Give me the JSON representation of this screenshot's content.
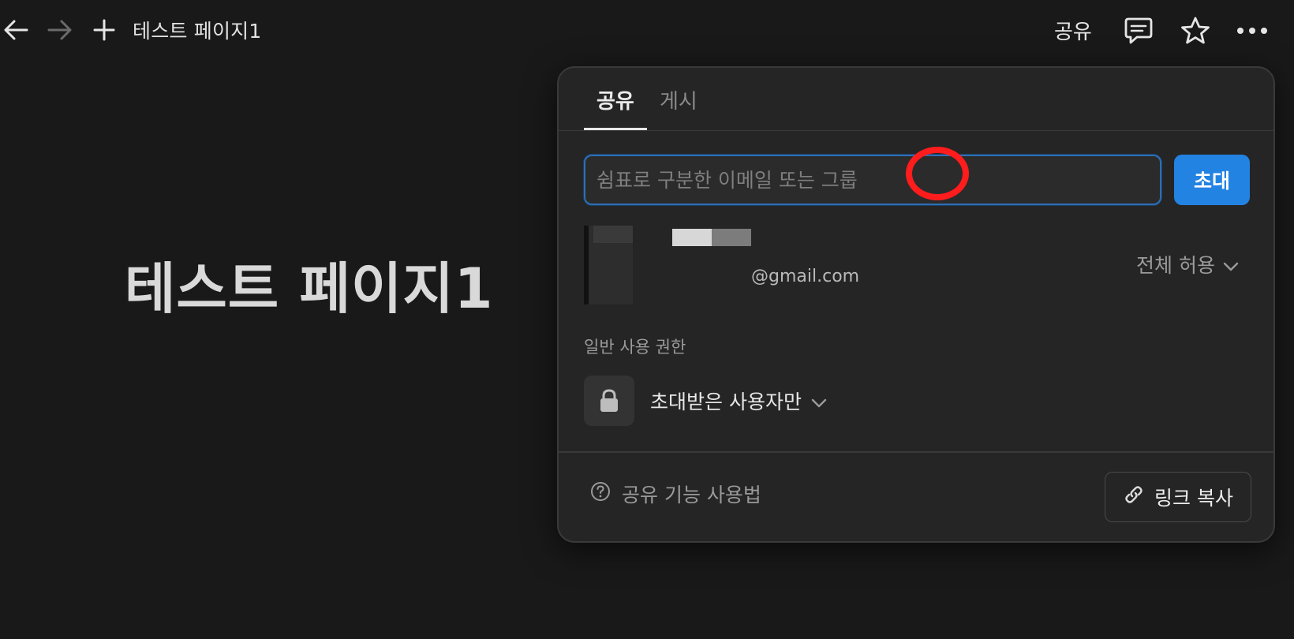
{
  "topbar": {
    "back_icon": "arrow-left-icon",
    "forward_icon": "arrow-right-icon",
    "new_icon": "plus-icon",
    "breadcrumb": "테스트 페이지1",
    "share_label": "공유",
    "comment_icon": "comment-icon",
    "favorite_icon": "star-icon",
    "more_icon": "more-horizontal-icon"
  },
  "page": {
    "title": "테스트 페이지1"
  },
  "share_popover": {
    "tabs": [
      {
        "label": "공유",
        "active": true
      },
      {
        "label": "게시",
        "active": false
      }
    ],
    "invite": {
      "placeholder": "쉼표로 구분한 이메일 또는 그룹",
      "value": "",
      "button_label": "초대"
    },
    "member": {
      "email": "@gmail.com",
      "permission": "전체 허용"
    },
    "general_access": {
      "section_label": "일반 사용 권한",
      "value": "초대받은 사용자만",
      "icon": "lock-icon"
    },
    "footer": {
      "help_label": "공유 기능 사용법",
      "copy_link_label": "링크 복사"
    }
  },
  "colors": {
    "background": "#191919",
    "popover": "#252525",
    "accent": "#2383e2",
    "annotation": "#ff1c1c"
  }
}
